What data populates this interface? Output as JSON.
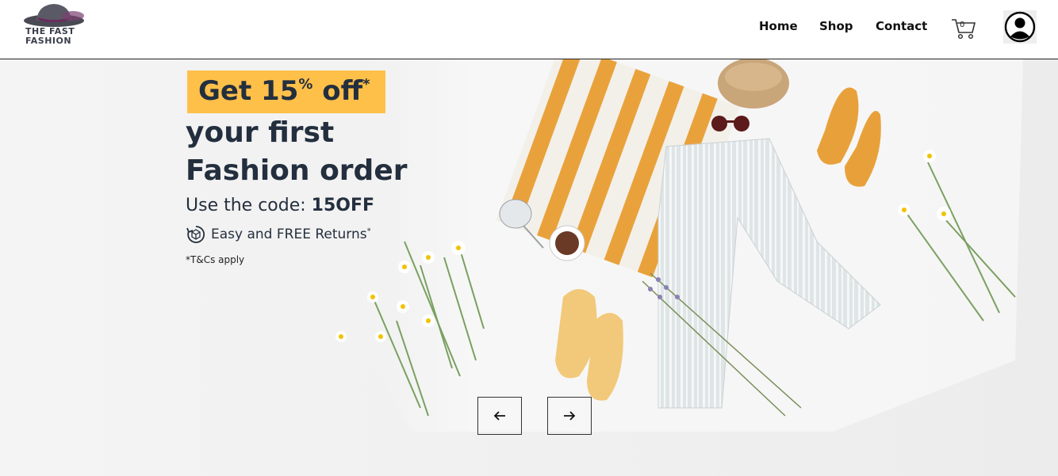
{
  "brand": {
    "line1": "THE FAST",
    "line2": "FASHION"
  },
  "nav": {
    "home": "Home",
    "shop": "Shop",
    "contact": "Contact"
  },
  "cart": {
    "count": "0"
  },
  "hero": {
    "promo_prefix": "Get 15",
    "promo_percent": "%",
    "promo_suffix": " off",
    "promo_star": "*",
    "line2": "your first",
    "line3": "Fashion order",
    "code_prefix": "Use the code: ",
    "code": "15OFF",
    "returns_text": "Easy and FREE Returns",
    "returns_star": "*",
    "terms": "*T&Cs apply"
  },
  "carousel": {
    "prev_icon": "arrow-left-icon",
    "next_icon": "arrow-right-icon"
  },
  "colors": {
    "accent": "#ffc04a",
    "text_dark": "#232f3e",
    "orange": "#e9a23b"
  }
}
